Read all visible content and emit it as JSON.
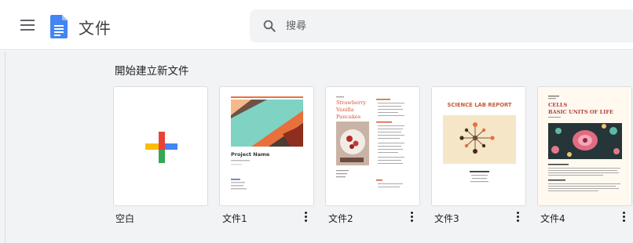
{
  "header": {
    "title": "文件",
    "menu_icon": "hamburger-menu-icon",
    "logo_icon": "docs-logo-icon",
    "brand_color": "#4285f4"
  },
  "search": {
    "placeholder": "搜尋",
    "value": ""
  },
  "gallery": {
    "title": "開始建立新文件",
    "templates": [
      {
        "label": "空白"
      },
      {
        "label": "文件1",
        "thumb_title": "Project Name"
      },
      {
        "label": "文件2",
        "thumb_title": "Strawberry Vanilla Pancakes"
      },
      {
        "label": "文件3",
        "thumb_title": "SCIENCE LAB REPORT"
      },
      {
        "label": "文件4",
        "thumb_title": "CELLS BASIC UNITS OF LIFE"
      }
    ]
  }
}
